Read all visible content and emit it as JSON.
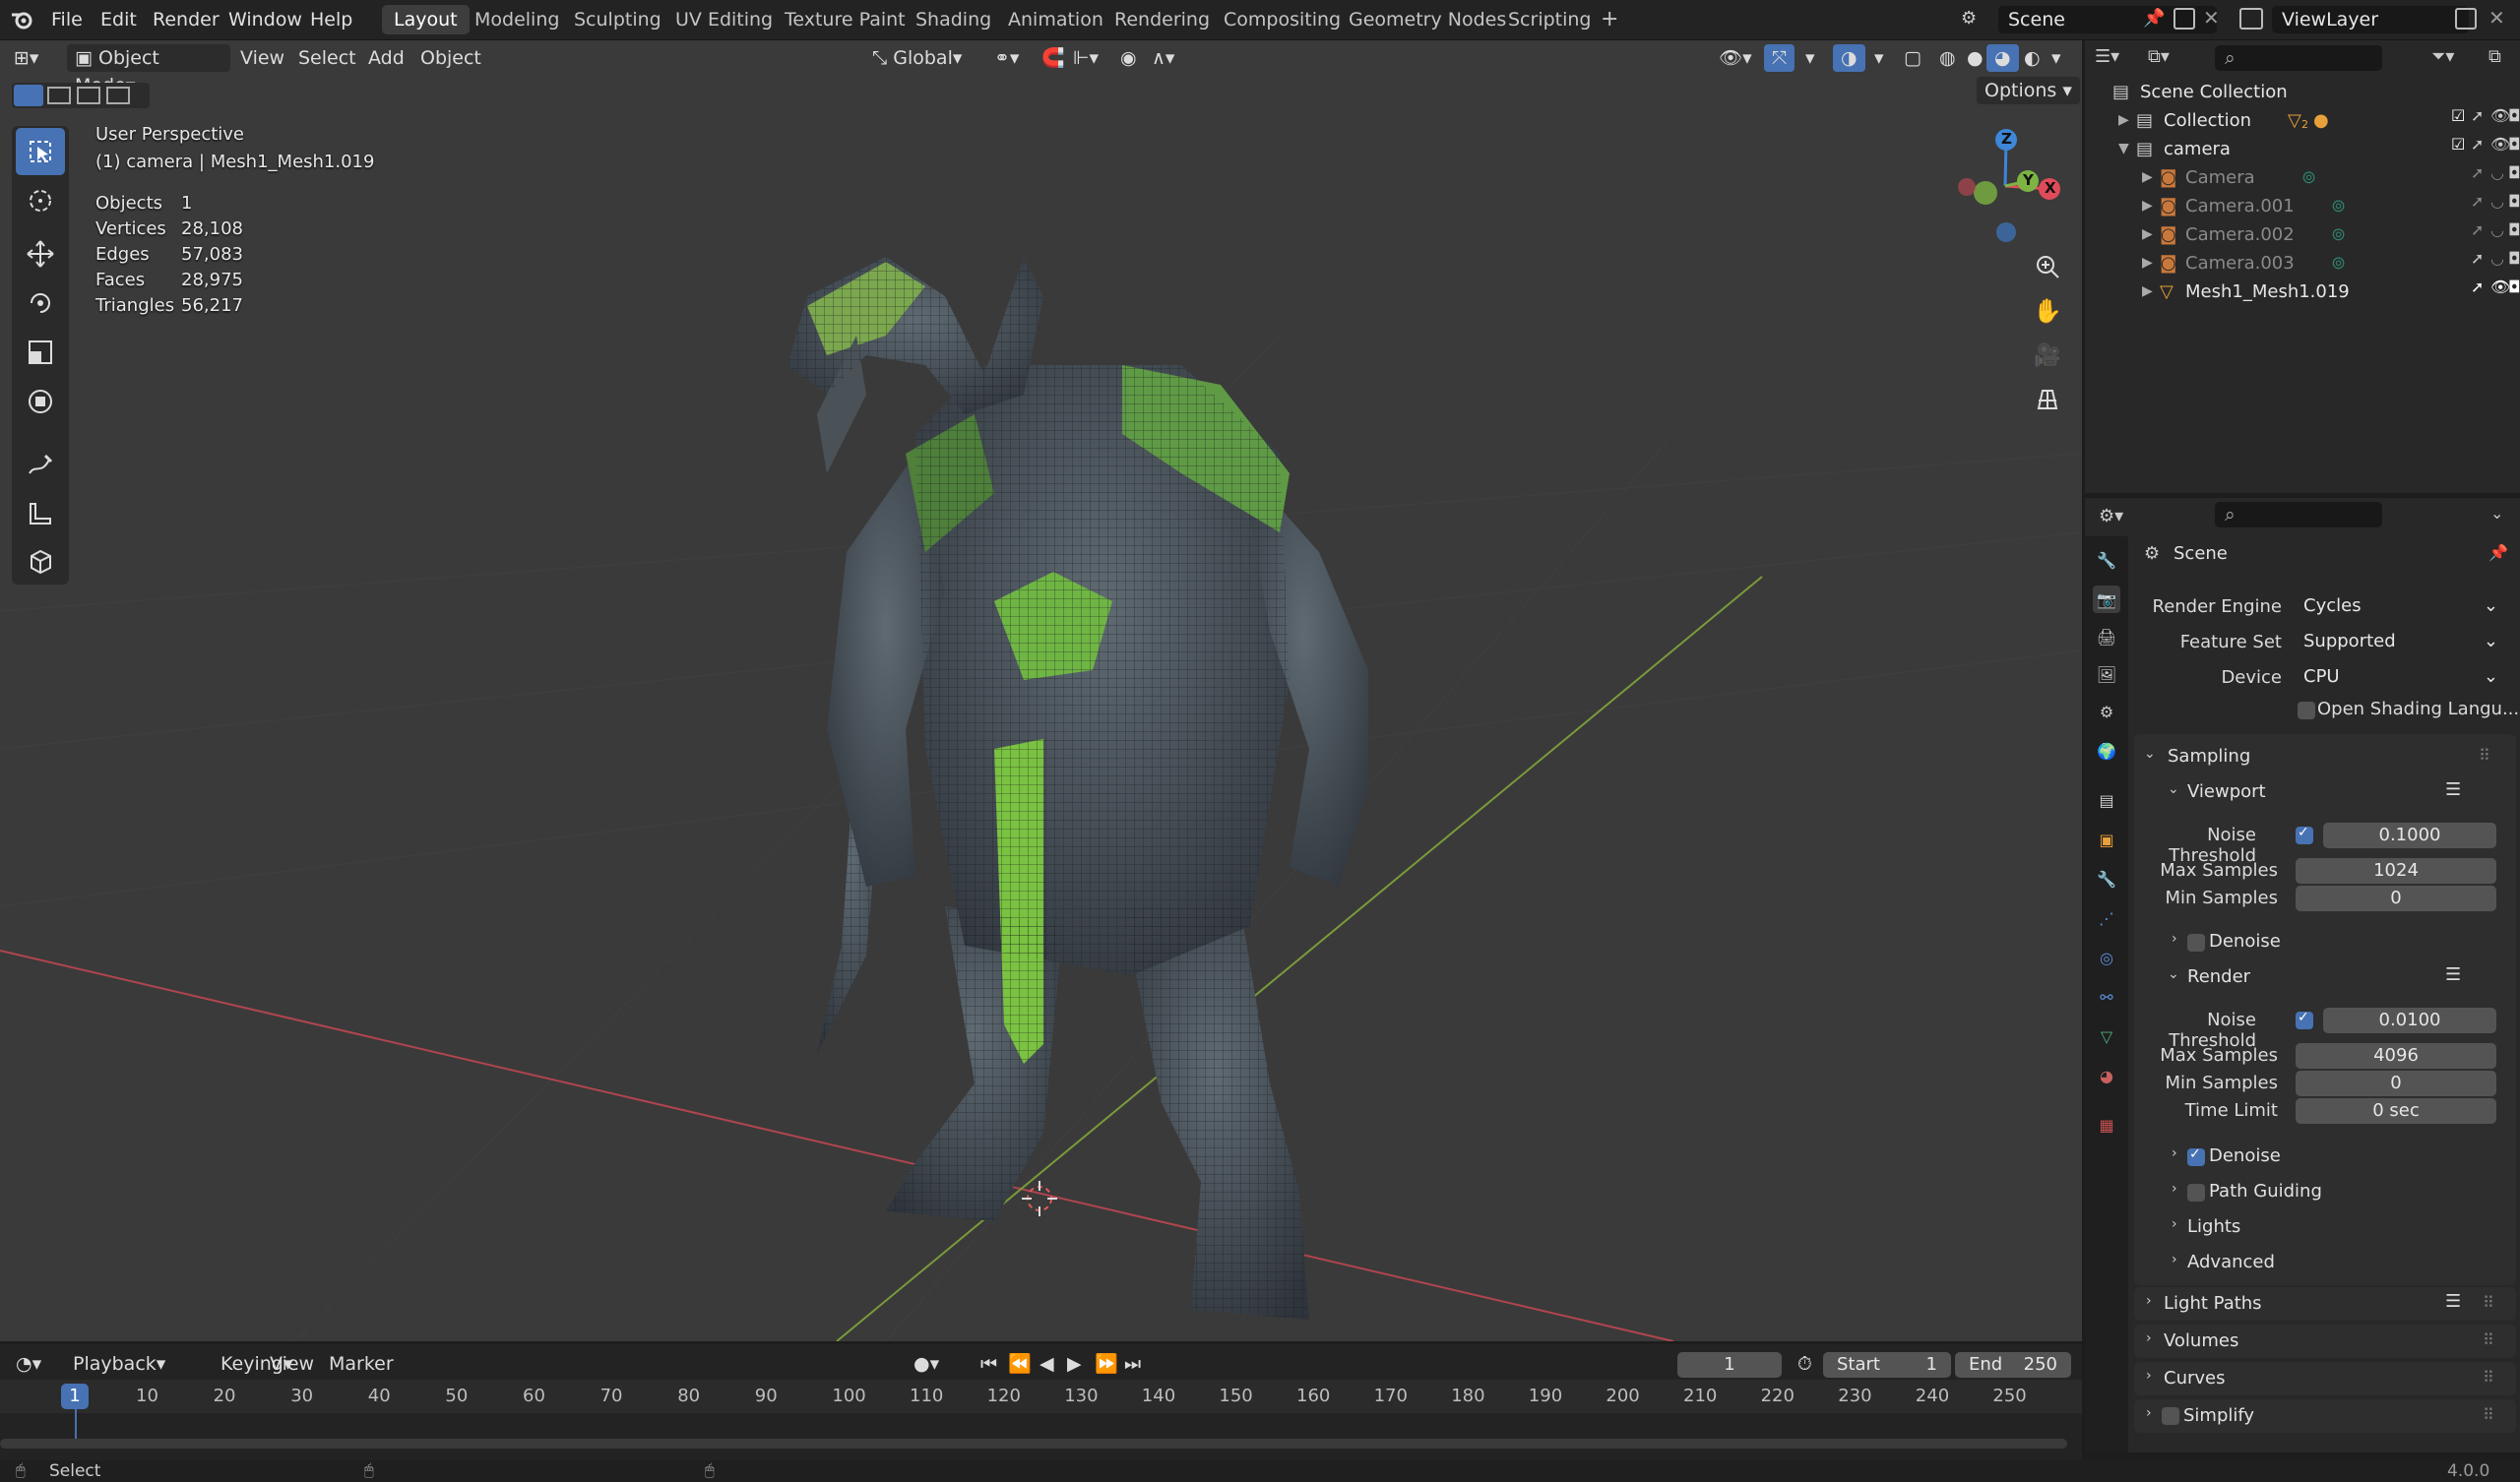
{
  "topbar": {
    "menus": [
      "File",
      "Edit",
      "Render",
      "Window",
      "Help"
    ],
    "workspaces": [
      "Layout",
      "Modeling",
      "Sculpting",
      "UV Editing",
      "Texture Paint",
      "Shading",
      "Animation",
      "Rendering",
      "Compositing",
      "Geometry Nodes",
      "Scripting"
    ],
    "active_workspace": "Layout",
    "add_tab": "+",
    "scene": "Scene",
    "view_layer": "ViewLayer"
  },
  "viewport_header": {
    "mode": "Object Mode",
    "menus": [
      "View",
      "Select",
      "Add",
      "Object"
    ],
    "orientation": "Global",
    "options": "Options"
  },
  "viewport_overlay": {
    "perspective": "User Perspective",
    "object_info": "(1) camera | Mesh1_Mesh1.019",
    "stats": [
      {
        "label": "Objects",
        "value": "1"
      },
      {
        "label": "Vertices",
        "value": "28,108"
      },
      {
        "label": "Edges",
        "value": "57,083"
      },
      {
        "label": "Faces",
        "value": "28,975"
      },
      {
        "label": "Triangles",
        "value": "56,217"
      }
    ],
    "gizmo": {
      "x": "X",
      "y": "Y",
      "z": "Z"
    }
  },
  "outliner": {
    "root": "Scene Collection",
    "rows": [
      {
        "label": "Collection",
        "indent": 1,
        "expanded": false,
        "badge": "2"
      },
      {
        "label": "camera",
        "indent": 1,
        "expanded": true
      },
      {
        "label": "Camera",
        "indent": 2
      },
      {
        "label": "Camera.001",
        "indent": 2
      },
      {
        "label": "Camera.002",
        "indent": 2
      },
      {
        "label": "Camera.003",
        "indent": 2
      },
      {
        "label": "Mesh1_Mesh1.019",
        "indent": 2
      }
    ]
  },
  "properties": {
    "context": "Scene",
    "render_engine_label": "Render Engine",
    "render_engine": "Cycles",
    "feature_set_label": "Feature Set",
    "feature_set": "Supported",
    "device_label": "Device",
    "device": "CPU",
    "osl": "Open Shading Langu...",
    "sampling": "Sampling",
    "viewport": "Viewport",
    "vp_noise_label": "Noise Threshold",
    "vp_noise": "0.1000",
    "vp_max_label": "Max Samples",
    "vp_max": "1024",
    "vp_min_label": "Min Samples",
    "vp_min": "0",
    "denoise": "Denoise",
    "render": "Render",
    "r_noise_label": "Noise Threshold",
    "r_noise": "0.0100",
    "r_max_label": "Max Samples",
    "r_max": "4096",
    "r_min_label": "Min Samples",
    "r_min": "0",
    "time_limit_label": "Time Limit",
    "time_limit": "0 sec",
    "r_denoise": "Denoise",
    "path_guiding": "Path Guiding",
    "lights": "Lights",
    "advanced": "Advanced",
    "light_paths": "Light Paths",
    "volumes": "Volumes",
    "curves": "Curves",
    "simplify": "Simplify"
  },
  "timeline": {
    "menus": [
      "Playback",
      "Keying",
      "View",
      "Marker"
    ],
    "current_frame": "1",
    "start_label": "Start",
    "start": "1",
    "end_label": "End",
    "end": "250",
    "ruler": [
      "10",
      "20",
      "30",
      "40",
      "50",
      "60",
      "70",
      "80",
      "90",
      "100",
      "110",
      "120",
      "130",
      "140",
      "150",
      "160",
      "170",
      "180",
      "190",
      "200",
      "210",
      "220",
      "230",
      "240",
      "250"
    ],
    "playhead": "1"
  },
  "status": {
    "select": "Select",
    "version": "4.0.0"
  },
  "colors": {
    "accent": "#4772b3",
    "x_axis": "#e04b5a",
    "y_axis": "#7cb342",
    "z_axis": "#3d86d8"
  }
}
